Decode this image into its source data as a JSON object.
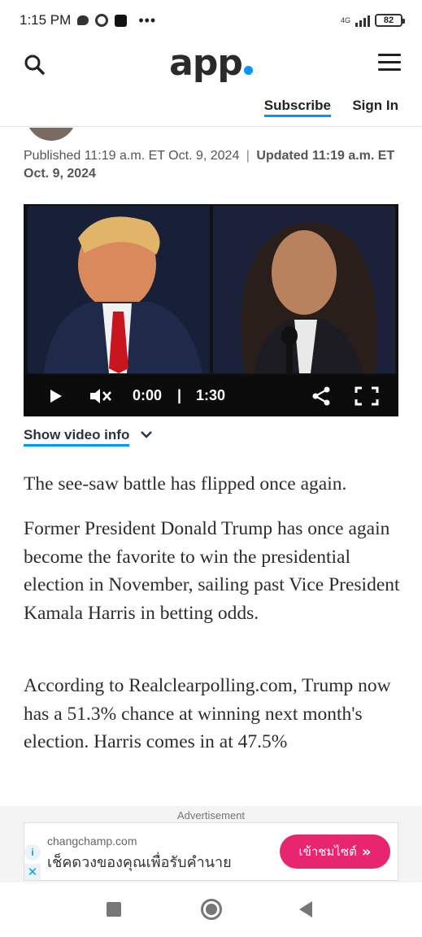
{
  "status_bar": {
    "time": "1:15 PM",
    "dots": "•••",
    "network": "4G",
    "battery": "82"
  },
  "header": {
    "logo_text": "app",
    "logo_dot_color": "#0098fe",
    "subscribe_label": "Subscribe",
    "signin_label": "Sign In"
  },
  "article": {
    "published_label": "Published 11:19 a.m. ET Oct. 9, 2024",
    "separator": "|",
    "updated_label": "Updated 11:19 a.m. ET Oct. 9, 2024",
    "paragraphs": [
      "The see-saw battle has flipped once again.",
      "Former President Donald Trump has once again become the favorite to win the presidential election in November, sailing past Vice President Kamala Harris in betting odds.",
      "According to Realclearpolling.com, Trump now has a 51.3% chance at winning next month's election. Harris comes in at 47.5%"
    ]
  },
  "video": {
    "current_time": "0:00",
    "time_separator": "|",
    "duration": "1:30",
    "show_info_label": "Show video info"
  },
  "ad": {
    "label": "Advertisement",
    "domain": "changchamp.com",
    "text": "เช็คดวงของคุณเพื่อรับคำนาย",
    "cta_label": "เข้าชมไซต์",
    "cta_arrows": "»",
    "cta_color": "#e8266f",
    "adchoice_glyph": "i",
    "close_glyph": "✕"
  }
}
